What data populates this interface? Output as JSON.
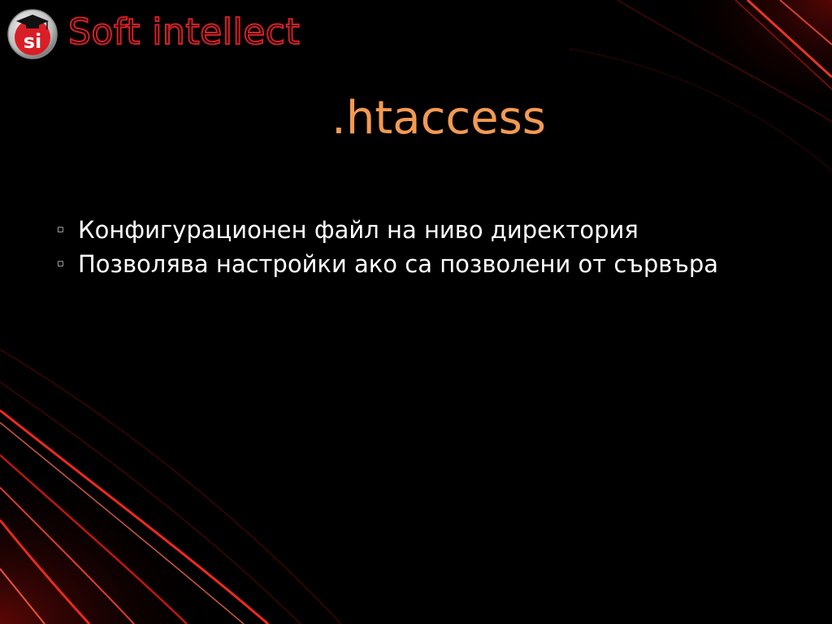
{
  "logo": {
    "badge_text": "si",
    "brand_name": "Soft intellect",
    "icon": "graduation-cap-icon"
  },
  "slide": {
    "title": ".htaccess",
    "bullets": [
      {
        "text": "Конфигурационен файл на ниво директория"
      },
      {
        "text": "Позволява настройки ако са позволени от сървъра"
      }
    ]
  },
  "theme": {
    "background": "#000000",
    "title_color": "#f39a52",
    "text_color": "#ffffff",
    "accent_red": "#d81e26"
  }
}
